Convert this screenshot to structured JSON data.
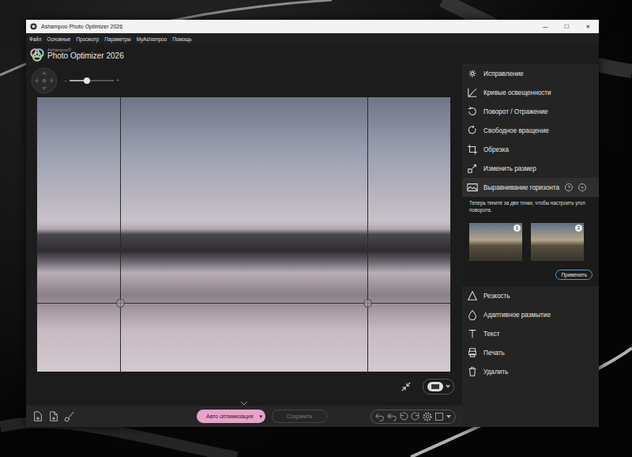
{
  "window": {
    "title": "Ashampoo Photo Optimizer 2026",
    "controls": [
      "—",
      "☐",
      "✕"
    ]
  },
  "menu": [
    "Файл",
    "Основные",
    "Просмотр",
    "Параметры",
    "MyAshampoo",
    "Помощь"
  ],
  "logo": {
    "brand": "Ashampoo®",
    "product": "Photo Optimizer 2026"
  },
  "zoom": {
    "level": 0.4
  },
  "tools": [
    {
      "label": "Исправление",
      "expanded": false
    },
    {
      "label": "Кривые освещенности",
      "expanded": false
    },
    {
      "label": "Поворот / Отражение",
      "expanded": false
    },
    {
      "label": "Свободное вращение",
      "expanded": false
    },
    {
      "label": "Обрезка",
      "expanded": false
    },
    {
      "label": "Изменить размер",
      "expanded": false
    },
    {
      "label": "Выравнивание горизонта",
      "expanded": true
    },
    {
      "label": "Резкость",
      "expanded": false
    },
    {
      "label": "Адаптивное размытие",
      "expanded": false
    },
    {
      "label": "Текст",
      "expanded": false
    },
    {
      "label": "Печать",
      "expanded": false
    },
    {
      "label": "Удалить",
      "expanded": false
    }
  ],
  "horizon_panel": {
    "help": "?",
    "close": "×",
    "hint": "Теперь тяните за две точки, чтобы настроить угол поворота.",
    "thumbnails": [
      {
        "badge": "1"
      },
      {
        "badge": "2"
      }
    ],
    "apply": "Применить"
  },
  "actions": {
    "auto": {
      "label": "Авто оптимизация",
      "dropdown": "▾"
    },
    "save": {
      "label": "Сохранить",
      "disabled": true
    }
  }
}
